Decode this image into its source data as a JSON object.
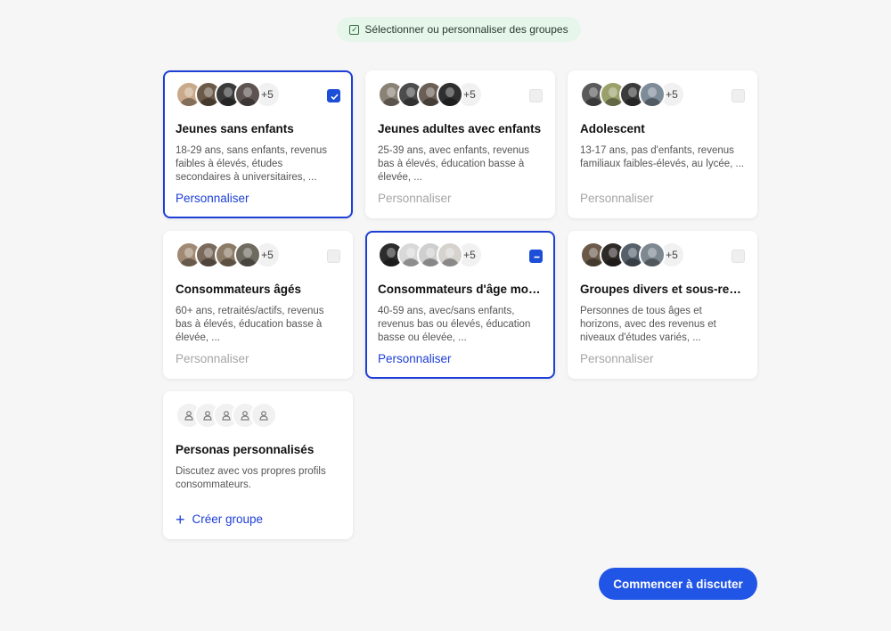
{
  "banner": {
    "label": "Sélectionner ou personnaliser des groupes",
    "icon": "checkbox-icon"
  },
  "groups": [
    {
      "title": "Jeunes sans enfants",
      "desc": "18-29 ans, sans enfants, revenus faibles à élevés, études secondaires à universitaires, ...",
      "more": "+5",
      "link": "Personnaliser",
      "state": "checked"
    },
    {
      "title": "Jeunes adultes avec enfants",
      "desc": "25-39 ans, avec enfants, revenus bas à élevés, éducation basse à élevée, ...",
      "more": "+5",
      "link": "Personnaliser",
      "state": "unchecked"
    },
    {
      "title": "Adolescent",
      "desc": "13-17 ans, pas d'enfants, revenus familiaux faibles-élevés, au lycée, ...",
      "more": "+5",
      "link": "Personnaliser",
      "state": "unchecked"
    },
    {
      "title": "Consommateurs âgés",
      "desc": "60+ ans, retraités/actifs, revenus bas à élevés, éducation basse à élevée, ...",
      "more": "+5",
      "link": "Personnaliser",
      "state": "unchecked"
    },
    {
      "title": "Consommateurs d'âge moy...",
      "desc": "40-59 ans, avec/sans enfants, revenus bas ou élevés, éducation basse ou élevée, ...",
      "more": "+5",
      "link": "Personnaliser",
      "state": "partial"
    },
    {
      "title": "Groupes divers et sous-rep...",
      "desc": "Personnes de tous âges et horizons, avec des revenus et niveaux d'études variés, ...",
      "more": "+5",
      "link": "Personnaliser",
      "state": "unchecked"
    }
  ],
  "custom": {
    "title": "Personas personnalisés",
    "desc": "Discutez avec vos propres profils consommateurs.",
    "create_label": "Créer groupe"
  },
  "cta_label": "Commencer à discuter",
  "colors": {
    "accent": "#1d4ed8",
    "button": "#2155e6",
    "banner_bg": "#e6f6ea"
  }
}
